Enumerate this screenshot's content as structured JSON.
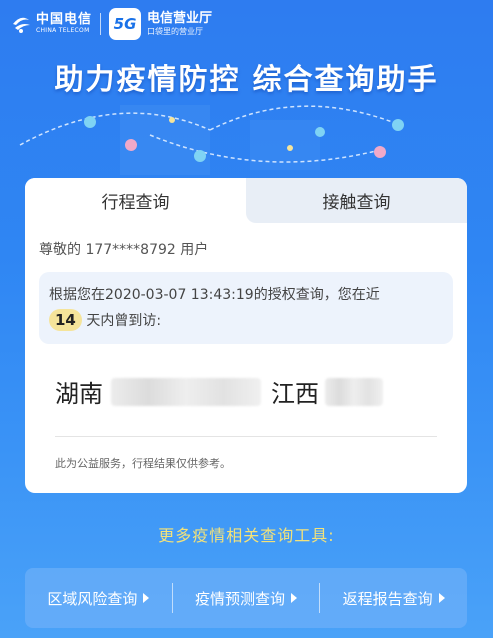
{
  "header": {
    "carrier_name": "中国电信",
    "carrier_en": "CHINA TELECOM",
    "app_badge": "5G",
    "app_name": "电信营业厅",
    "app_slogan": "口袋里的营业厅"
  },
  "hero": {
    "title": "助力疫情防控 综合查询助手"
  },
  "tabs": [
    {
      "label": "行程查询",
      "active": true
    },
    {
      "label": "接触查询",
      "active": false
    }
  ],
  "card": {
    "greeting_prefix": "尊敬的",
    "phone": "177****8792",
    "greeting_suffix": "用户",
    "notice_part1": "根据您在2020-03-07 13:43:19的授权查询，您在近",
    "days": "14",
    "notice_part2": "天内曾到访:",
    "places": [
      "湖南",
      "江西"
    ],
    "disclaimer": "此为公益服务，行程结果仅供参考。"
  },
  "more": {
    "title": "更多疫情相关查询工具:",
    "tools": [
      "区域风险查询",
      "疫情预测查询",
      "返程报告查询"
    ]
  },
  "colors": {
    "background": "#2f86f3",
    "accent_yellow": "#f3e27a",
    "badge_yellow": "#f5e49a",
    "brand_red": "#e8302f"
  }
}
